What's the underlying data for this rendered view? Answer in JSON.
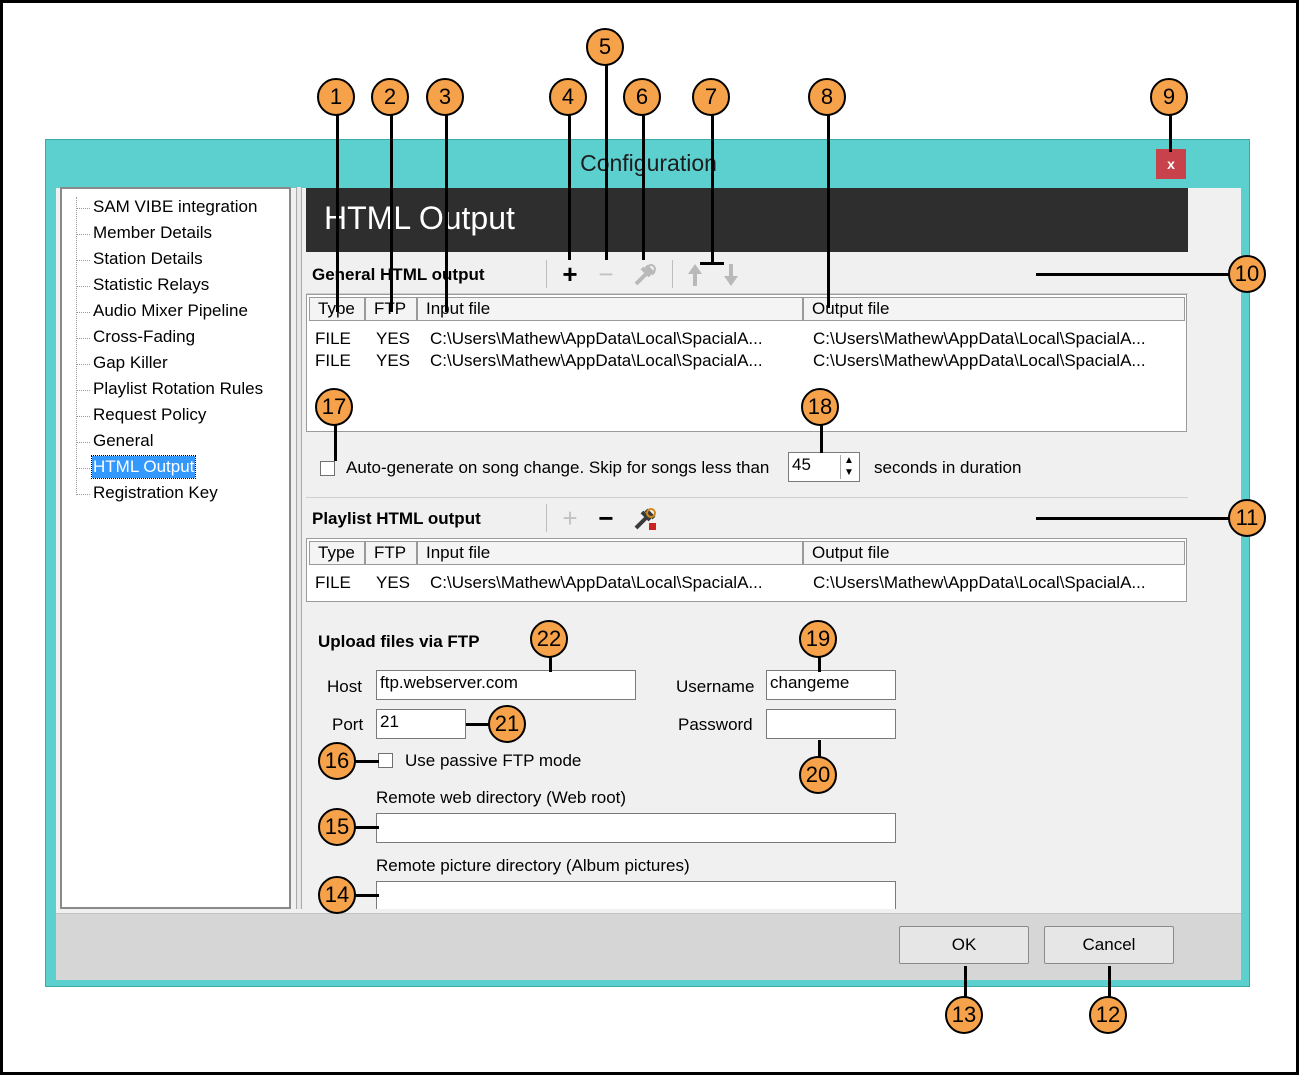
{
  "window": {
    "title": "Configuration",
    "close_label": "x"
  },
  "tree": {
    "items": [
      {
        "label": "SAM VIBE integration",
        "selected": false
      },
      {
        "label": "Member Details",
        "selected": false
      },
      {
        "label": "Station Details",
        "selected": false
      },
      {
        "label": "Statistic Relays",
        "selected": false
      },
      {
        "label": "Audio Mixer Pipeline",
        "selected": false
      },
      {
        "label": "Cross-Fading",
        "selected": false
      },
      {
        "label": "Gap Killer",
        "selected": false
      },
      {
        "label": "Playlist Rotation Rules",
        "selected": false
      },
      {
        "label": "Request Policy",
        "selected": false
      },
      {
        "label": "General",
        "selected": false
      },
      {
        "label": "HTML Output",
        "selected": true
      },
      {
        "label": "Registration Key",
        "selected": false
      }
    ]
  },
  "header": {
    "title": "HTML Output"
  },
  "general": {
    "label": "General HTML output",
    "columns": [
      "Type",
      "FTP",
      "Input file",
      "Output file"
    ],
    "rows": [
      [
        "FILE",
        "YES",
        "C:\\Users\\Mathew\\AppData\\Local\\SpacialA...",
        "C:\\Users\\Mathew\\AppData\\Local\\SpacialA..."
      ],
      [
        "FILE",
        "YES",
        "C:\\Users\\Mathew\\AppData\\Local\\SpacialA...",
        "C:\\Users\\Mathew\\AppData\\Local\\SpacialA..."
      ]
    ],
    "toolbar": {
      "add": "+",
      "remove": "−"
    }
  },
  "autogen": {
    "label": "Auto-generate on song change. Skip for songs less than",
    "seconds_value": "45",
    "suffix": "seconds in duration",
    "checked": false
  },
  "playlist": {
    "label": "Playlist HTML output",
    "columns": [
      "Type",
      "FTP",
      "Input file",
      "Output file"
    ],
    "rows": [
      [
        "FILE",
        "YES",
        "C:\\Users\\Mathew\\AppData\\Local\\SpacialA...",
        "C:\\Users\\Mathew\\AppData\\Local\\SpacialA..."
      ]
    ],
    "toolbar": {
      "add": "+",
      "remove": "−"
    }
  },
  "ftp": {
    "title": "Upload files via FTP",
    "host_label": "Host",
    "host_value": "ftp.webserver.com",
    "port_label": "Port",
    "port_value": "21",
    "username_label": "Username",
    "username_value": "changeme",
    "password_label": "Password",
    "password_value": "",
    "passive_label": "Use passive FTP mode",
    "passive_checked": false,
    "webroot_label": "Remote web directory (Web root)",
    "webroot_value": "",
    "pictures_label": "Remote picture directory (Album pictures)",
    "pictures_value": ""
  },
  "buttons": {
    "ok": "OK",
    "cancel": "Cancel"
  },
  "callouts": [
    "1",
    "2",
    "3",
    "4",
    "5",
    "6",
    "7",
    "8",
    "9",
    "10",
    "11",
    "12",
    "13",
    "14",
    "15",
    "16",
    "17",
    "18",
    "19",
    "20",
    "21",
    "22"
  ],
  "colors": {
    "window_frame": "#5ccfcf",
    "close": "#c7424a",
    "header": "#2e2e2e",
    "callout": "#f6a24a",
    "selection": "#3399ff"
  }
}
